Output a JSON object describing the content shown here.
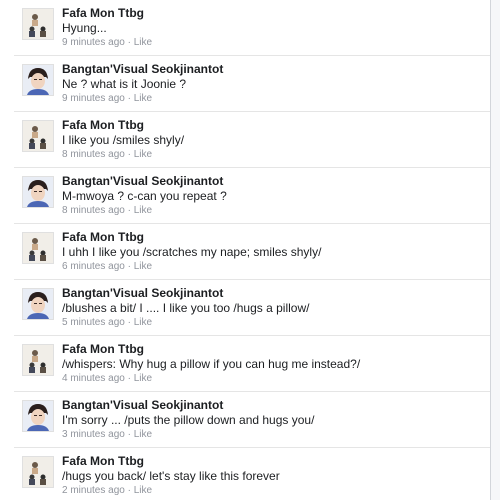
{
  "comments": [
    {
      "author": "Fafa Mon Ttbg",
      "avatar": "avatar-fafa",
      "text": "Hyung...",
      "time": "9 minutes ago",
      "like": "Like"
    },
    {
      "author": "Bangtan'Visual Seokjinantot",
      "avatar": "avatar-jin",
      "text": "Ne ? what is it Joonie ?",
      "time": "9 minutes ago",
      "like": "Like"
    },
    {
      "author": "Fafa Mon Ttbg",
      "avatar": "avatar-fafa",
      "text": "I like you /smiles shyly/",
      "time": "8 minutes ago",
      "like": "Like"
    },
    {
      "author": "Bangtan'Visual Seokjinantot",
      "avatar": "avatar-jin",
      "text": "M-mwoya ? c-can you repeat ?",
      "time": "8 minutes ago",
      "like": "Like"
    },
    {
      "author": "Fafa Mon Ttbg",
      "avatar": "avatar-fafa",
      "text": "I uhh I like you /scratches my nape; smiles shyly/",
      "time": "6 minutes ago",
      "like": "Like"
    },
    {
      "author": "Bangtan'Visual Seokjinantot",
      "avatar": "avatar-jin",
      "text": "/blushes a bit/ I .... I like you too /hugs a pillow/",
      "time": "5 minutes ago",
      "like": "Like"
    },
    {
      "author": "Fafa Mon Ttbg",
      "avatar": "avatar-fafa",
      "text": "/whispers: Why hug a pillow if you can hug me instead?/",
      "time": "4 minutes ago",
      "like": "Like"
    },
    {
      "author": "Bangtan'Visual Seokjinantot",
      "avatar": "avatar-jin",
      "text": "I'm sorry ... /puts the pillow down and hugs you/",
      "time": "3 minutes ago",
      "like": "Like"
    },
    {
      "author": "Fafa Mon Ttbg",
      "avatar": "avatar-fafa",
      "text": "/hugs you back/ let's stay like this forever",
      "time": "2 minutes ago",
      "like": "Like"
    }
  ],
  "separator": "·",
  "colors": {
    "author": "#1c1e21",
    "meta": "#90949c",
    "divider": "#e5e5e5"
  }
}
